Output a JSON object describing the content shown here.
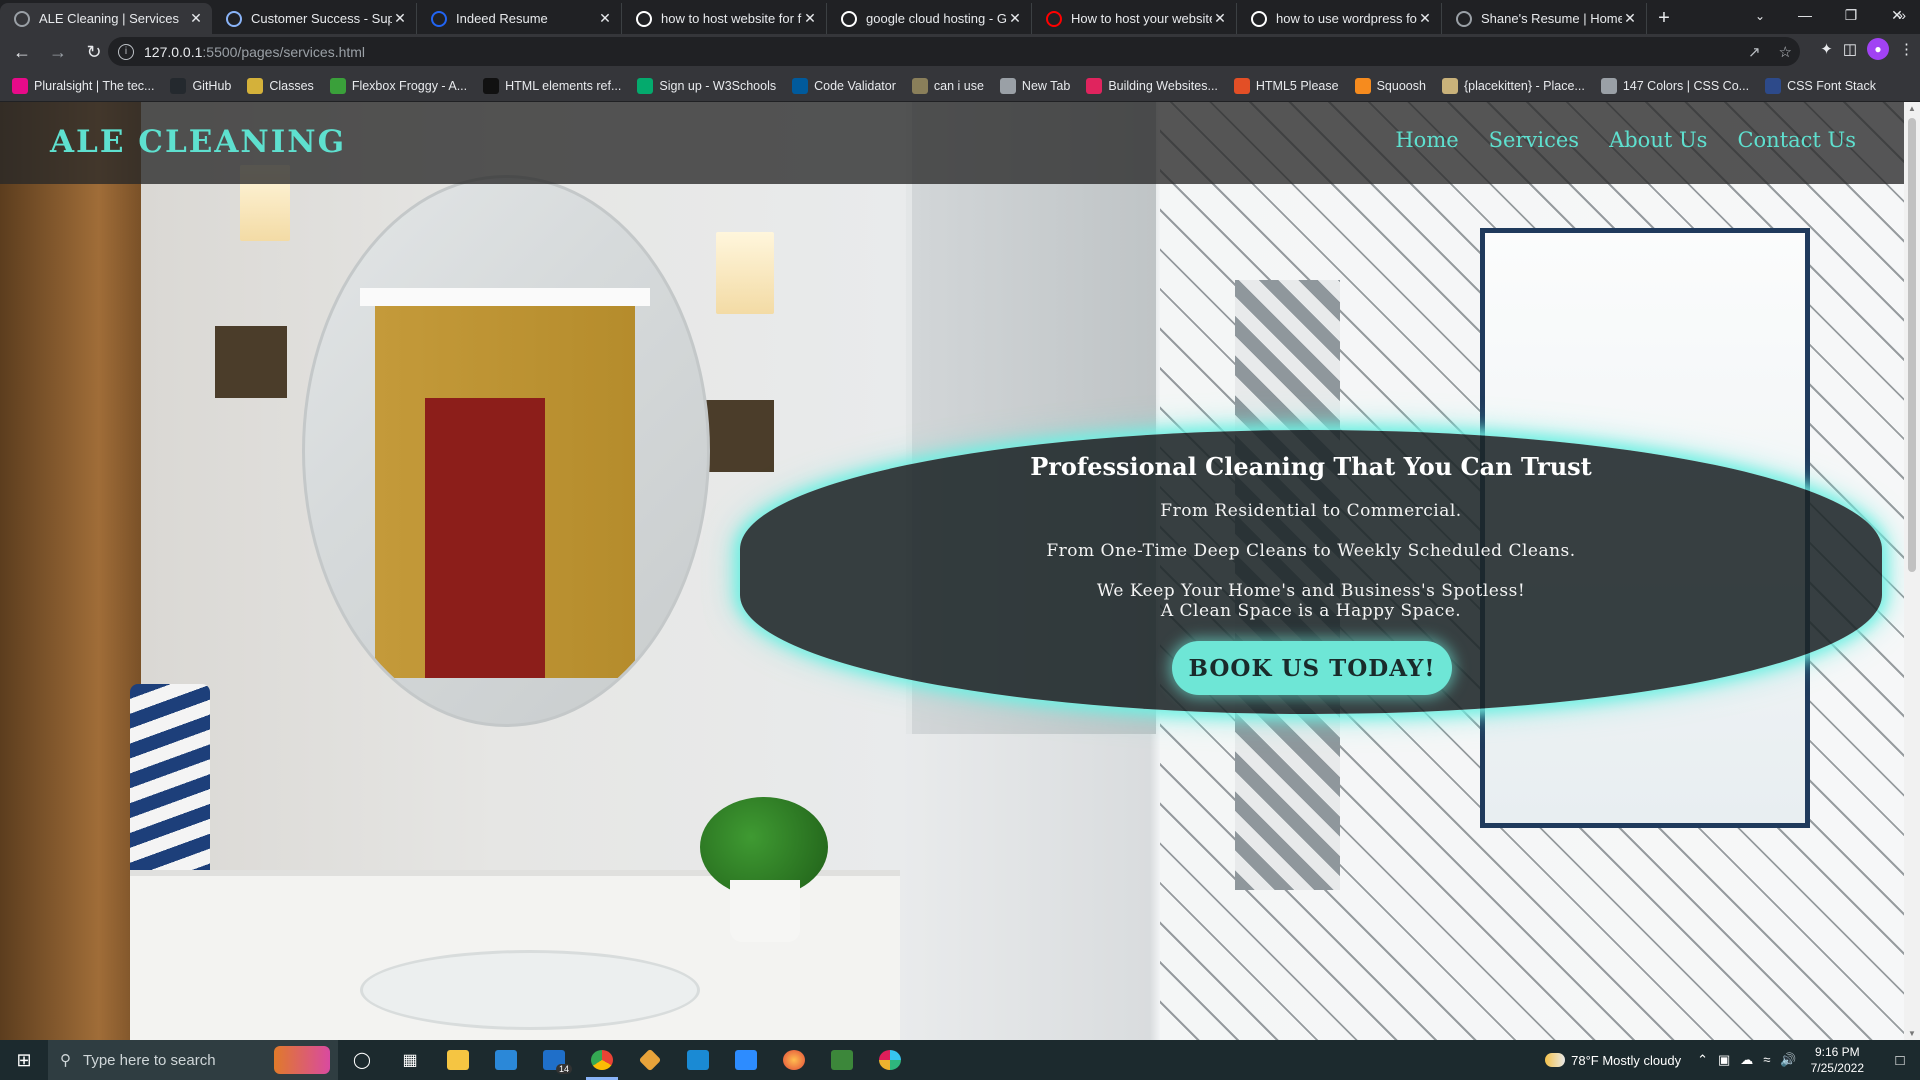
{
  "browser": {
    "tabs": [
      {
        "title": "ALE Cleaning | Services",
        "favicon": "globe-icon",
        "color": "#9aa0a6",
        "active": true
      },
      {
        "title": "Customer Success - Suppo",
        "favicon": "loading-icon",
        "color": "#8ab4f8",
        "active": false
      },
      {
        "title": "Indeed Resume",
        "favicon": "indeed-icon",
        "color": "#2164f3",
        "active": false
      },
      {
        "title": "how to host website for fr",
        "favicon": "google-icon",
        "color": "#ffffff",
        "active": false
      },
      {
        "title": "google cloud hosting - Go",
        "favicon": "google-icon",
        "color": "#ffffff",
        "active": false
      },
      {
        "title": "How to host your website",
        "favicon": "youtube-icon",
        "color": "#ff0000",
        "active": false
      },
      {
        "title": "how to use wordpress for",
        "favicon": "google-icon",
        "color": "#ffffff",
        "active": false
      },
      {
        "title": "Shane's Resume | Home",
        "favicon": "globe-icon",
        "color": "#9aa0a6",
        "active": false
      }
    ],
    "url_host": "127.0.0.1",
    "url_path": ":5500/pages/services.html",
    "bookmarks": [
      {
        "label": "Pluralsight | The tec...",
        "icon": "pluralsight-icon",
        "color": "#e80a89"
      },
      {
        "label": "GitHub",
        "icon": "github-icon",
        "color": "#24292e"
      },
      {
        "label": "Classes",
        "icon": "folder-icon",
        "color": "#d4b13a"
      },
      {
        "label": "Flexbox Froggy - A...",
        "icon": "frog-icon",
        "color": "#3aa03a"
      },
      {
        "label": "HTML elements ref...",
        "icon": "mdn-icon",
        "color": "#111111"
      },
      {
        "label": "Sign up - W3Schools",
        "icon": "w3schools-icon",
        "color": "#04aa6d"
      },
      {
        "label": "Code Validator",
        "icon": "w3c-icon",
        "color": "#005a9c"
      },
      {
        "label": "can i use",
        "icon": "caniuse-icon",
        "color": "#8a7f5a"
      },
      {
        "label": "New Tab",
        "icon": "globe-icon",
        "color": "#9aa0a6"
      },
      {
        "label": "Building Websites...",
        "icon": "play-icon",
        "color": "#e0245e"
      },
      {
        "label": "HTML5 Please",
        "icon": "html5-icon",
        "color": "#e34f26"
      },
      {
        "label": "Squoosh",
        "icon": "squoosh-icon",
        "color": "#f68b1e"
      },
      {
        "label": "{placekitten} - Place...",
        "icon": "kitten-icon",
        "color": "#c9b27a"
      },
      {
        "label": "147 Colors | CSS Co...",
        "icon": "globe-icon",
        "color": "#9aa0a6"
      },
      {
        "label": "CSS Font Stack",
        "icon": "cssfont-icon",
        "color": "#2d4a8a"
      }
    ]
  },
  "site": {
    "logo": "ALE CLEANING",
    "nav": [
      "Home",
      "Services",
      "About Us",
      "Contact Us"
    ],
    "hero": {
      "heading": "Professional Cleaning That You Can Trust",
      "line1": "From Residential to Commercial.",
      "line2": "From One-Time Deep Cleans to Weekly Scheduled Cleans.",
      "line3": "We Keep Your Home's and Business's Spotless!",
      "line4": "A Clean Space is a Happy Space.",
      "cta": "BOOK US TODAY!"
    },
    "accent": "#5ee0cf"
  },
  "taskbar": {
    "search_placeholder": "Type here to search",
    "mail_badge": "14",
    "weather": "78°F  Mostly cloudy",
    "time": "9:16 PM",
    "date": "7/25/2022"
  }
}
